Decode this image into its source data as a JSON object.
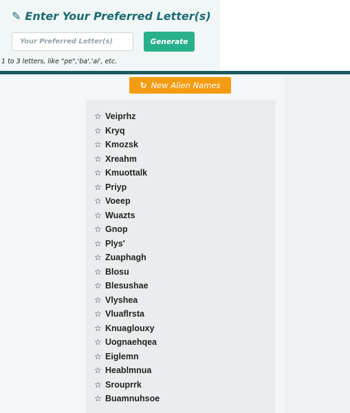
{
  "form": {
    "title": "Enter Your Preferred Letter(s)",
    "input_placeholder": "Your Preferred Letter(s)",
    "input_value": "",
    "generate_label": "Generate",
    "hint": "1 to 3 letters, like \"pe\",'ba','ai', etc."
  },
  "actions": {
    "new_names_label": "New Alien Names"
  },
  "icons": {
    "title_icon": "edit-icon",
    "refresh_icon": "refresh-icon",
    "item_icon": "star-outline-icon"
  },
  "colors": {
    "title": "#1d6a72",
    "generate_button": "#27b08a",
    "new_names_button": "#f39c12",
    "divider": "#1c5a62"
  },
  "names": [
    "Veiprhz",
    "Kryq",
    "Kmozsk",
    "Xreahm",
    "Kmuottalk",
    "Priyp",
    "Voeep",
    "Wuazts",
    "Gnop",
    "Plys'",
    "Zuaphagh",
    "Blosu",
    "Blesushae",
    "Vlyshea",
    "Vluaflrsta",
    "Knuaglouxy",
    "Uognaehqea",
    "Eiglemn",
    "Heablmnua",
    "Srouprrk",
    "Buamnuhsoe"
  ]
}
